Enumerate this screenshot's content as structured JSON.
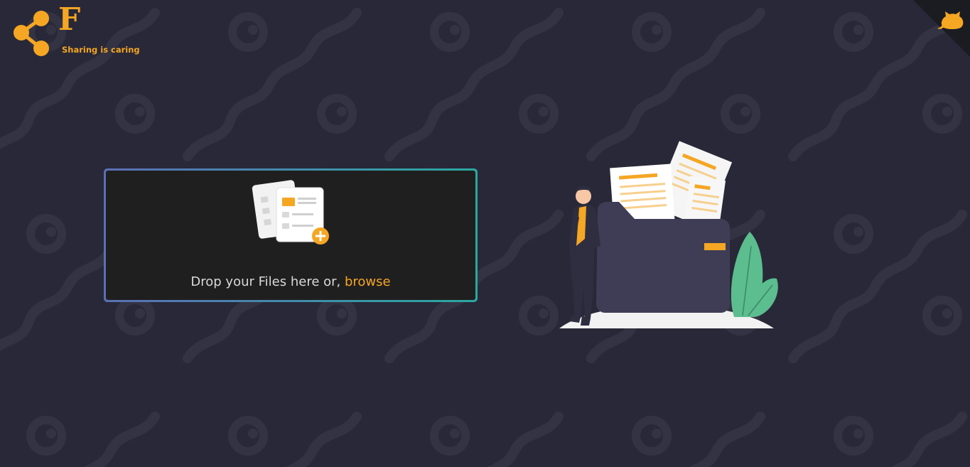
{
  "brand": {
    "letter": "F",
    "tagline": "Sharing is caring",
    "accent": "#f5a623",
    "background": "#282838"
  },
  "upload": {
    "prompt": "Drop your Files here or,",
    "browse_label": "browse",
    "border_gradient": [
      "#5b6fb6",
      "#2aa8a0"
    ]
  },
  "icons": {
    "logo": "share-nodes-icon",
    "github": "github-octocat-icon",
    "upload": "add-files-icon",
    "illustration": "file-folder-illustration"
  }
}
